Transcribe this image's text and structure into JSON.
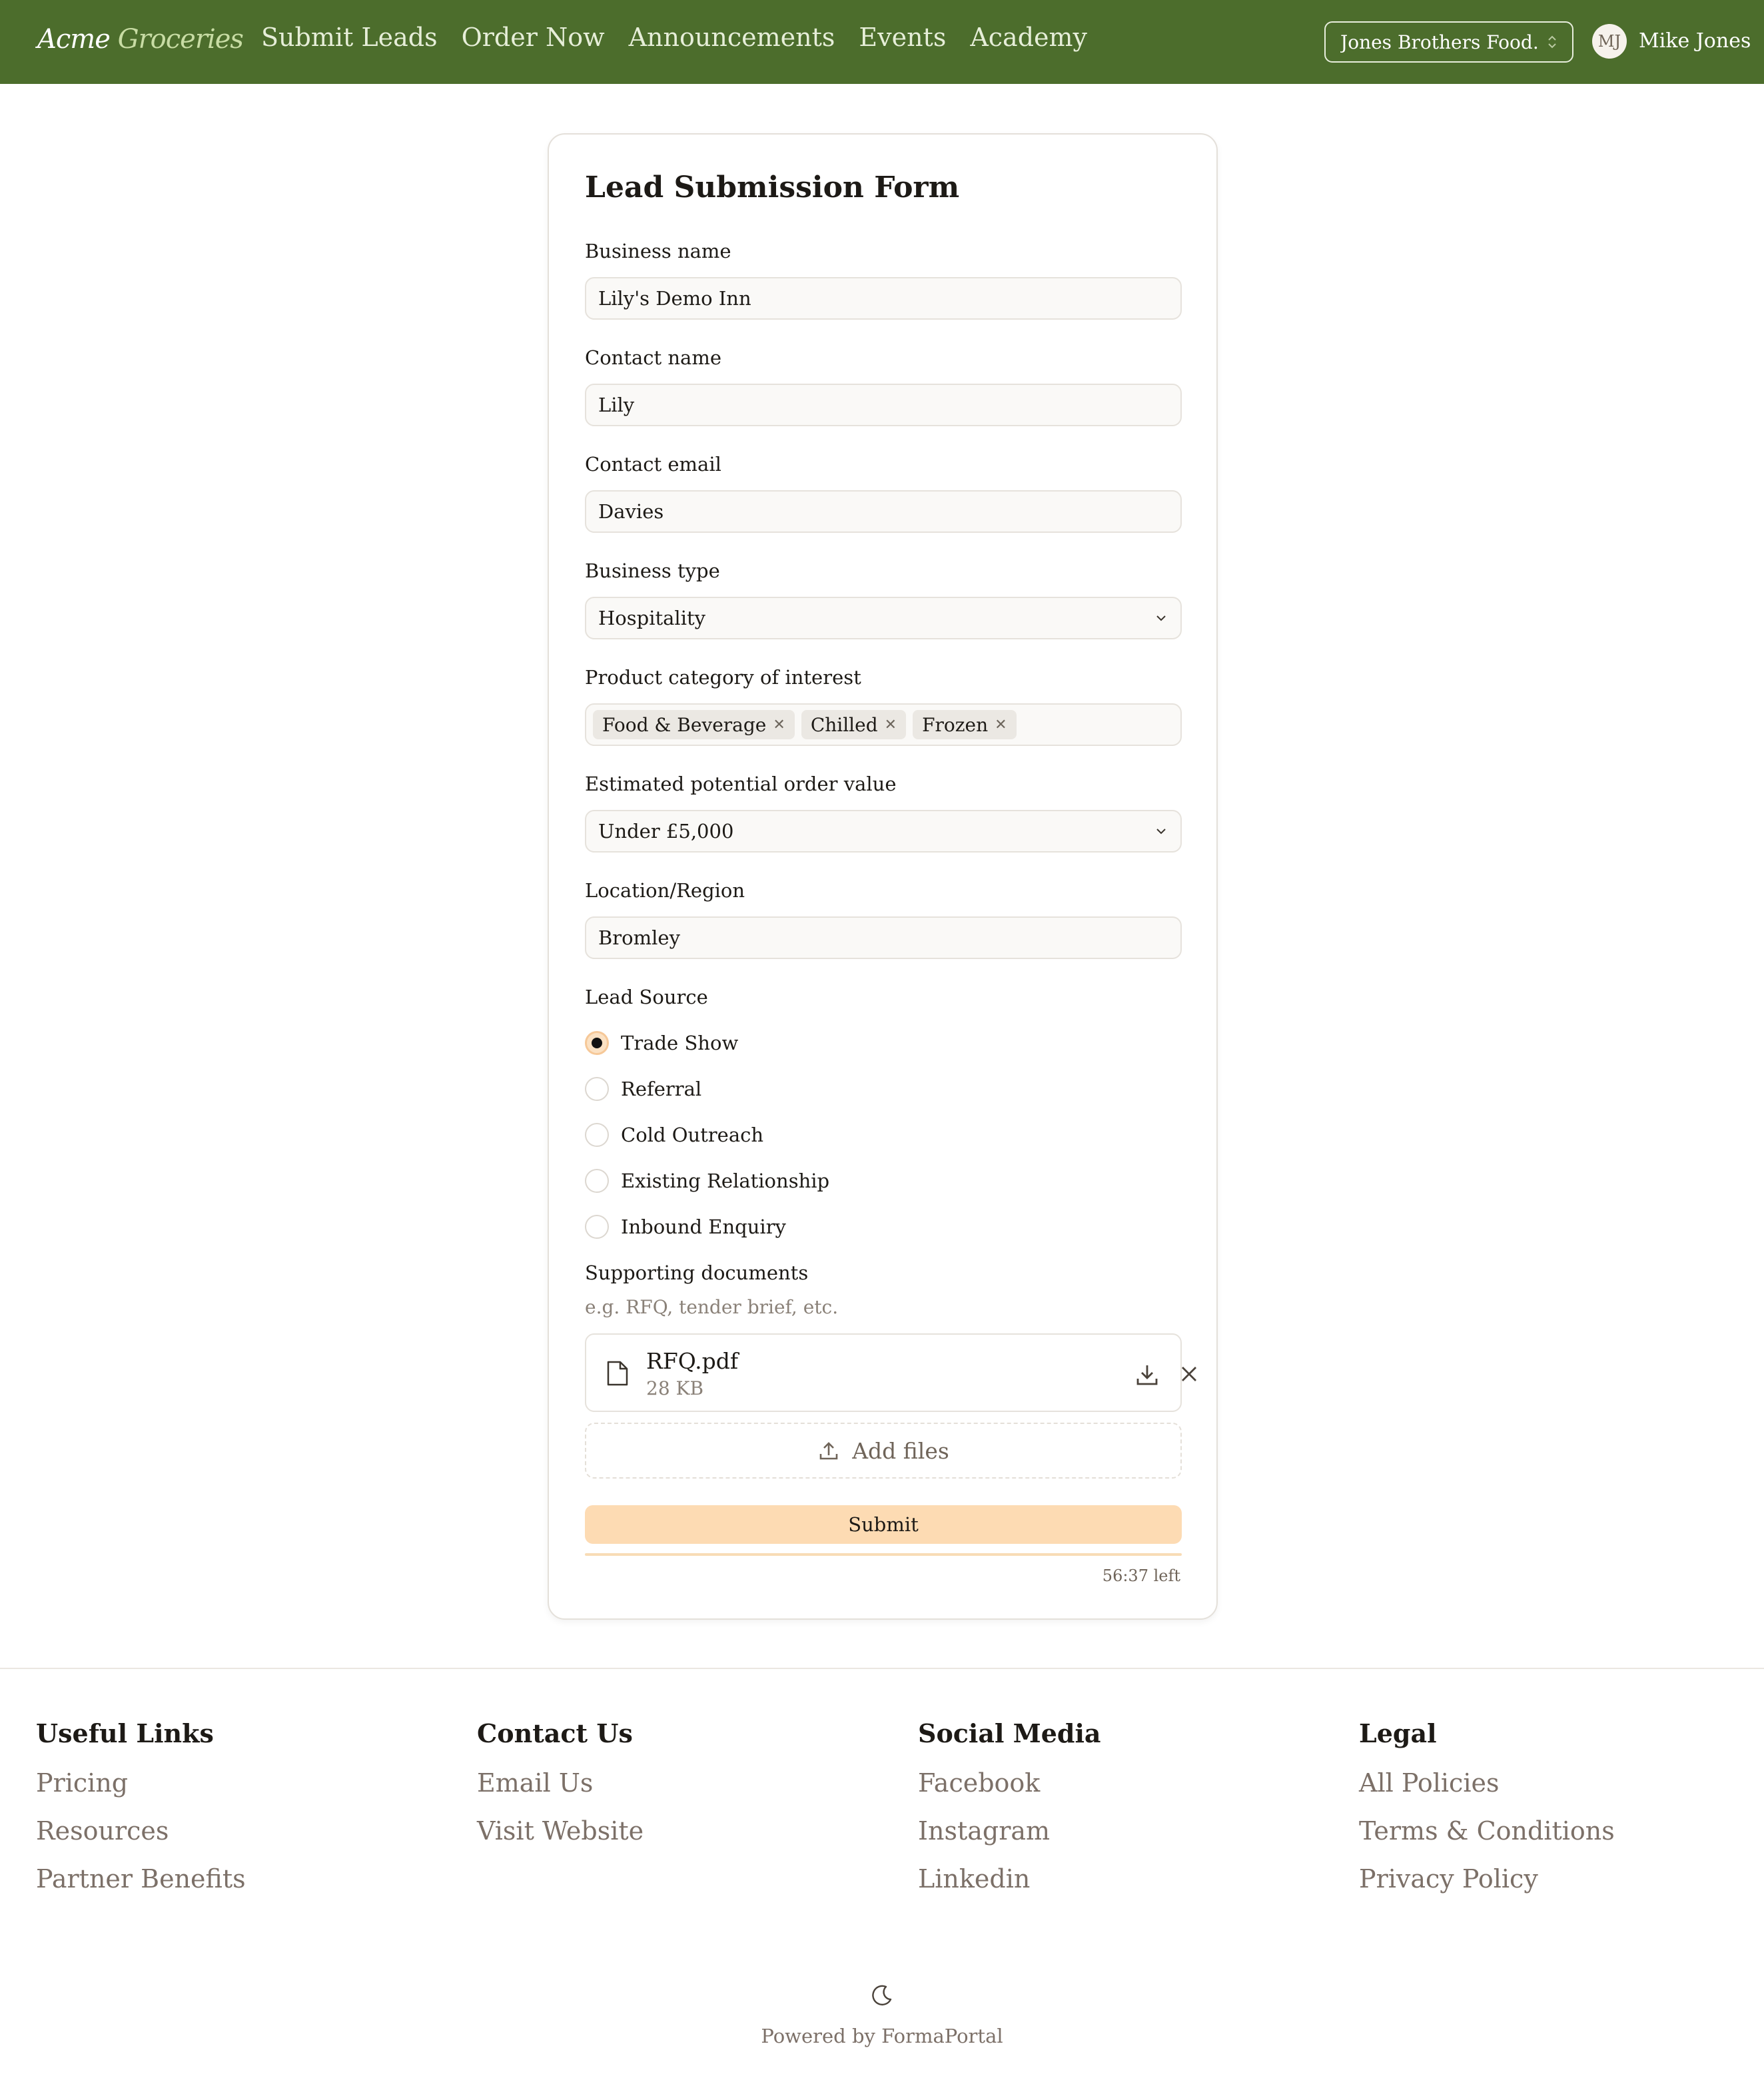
{
  "header": {
    "brand_part1": "Acme",
    "brand_part2": "Groceries",
    "nav": [
      "Submit Leads",
      "Order Now",
      "Announcements",
      "Events",
      "Academy"
    ],
    "org_selector": "Jones Brothers Food...",
    "user_initials": "MJ",
    "user_name": "Mike Jones",
    "bar_color": "#4c6d2c"
  },
  "form": {
    "title": "Lead Submission Form",
    "business_name": {
      "label": "Business name",
      "value": "Lily's Demo Inn"
    },
    "contact_name": {
      "label": "Contact name",
      "value": "Lily"
    },
    "contact_email": {
      "label": "Contact email",
      "value": "Davies"
    },
    "business_type": {
      "label": "Business type",
      "value": "Hospitality"
    },
    "product_category": {
      "label": "Product category of interest",
      "tags": [
        "Food & Beverage",
        "Chilled",
        "Frozen"
      ]
    },
    "order_value": {
      "label": "Estimated potential order value",
      "value": "Under £5,000"
    },
    "location": {
      "label": "Location/Region",
      "value": "Bromley"
    },
    "lead_source": {
      "label": "Lead Source",
      "options": [
        "Trade Show",
        "Referral",
        "Cold Outreach",
        "Existing Relationship",
        "Inbound Enquiry"
      ],
      "selected": "Trade Show"
    },
    "documents": {
      "label": "Supporting documents",
      "hint": "e.g. RFQ, tender brief, etc.",
      "file_name": "RFQ.pdf",
      "file_size": "28 KB",
      "add_label": "Add files"
    },
    "submit_label": "Submit",
    "time_left": "56:37 left",
    "time_progress_fraction": 1.0,
    "accent_color": "#fddbb3"
  },
  "footer": {
    "columns": [
      {
        "heading": "Useful Links",
        "links": [
          "Pricing",
          "Resources",
          "Partner Benefits"
        ]
      },
      {
        "heading": "Contact Us",
        "links": [
          "Email Us",
          "Visit Website"
        ]
      },
      {
        "heading": "Social Media",
        "links": [
          "Facebook",
          "Instagram",
          "Linkedin"
        ]
      },
      {
        "heading": "Legal",
        "links": [
          "All Policies",
          "Terms & Conditions",
          "Privacy Policy"
        ]
      }
    ],
    "theme_icon": "moon-icon",
    "powered_by": "Powered by FormaPortal"
  }
}
